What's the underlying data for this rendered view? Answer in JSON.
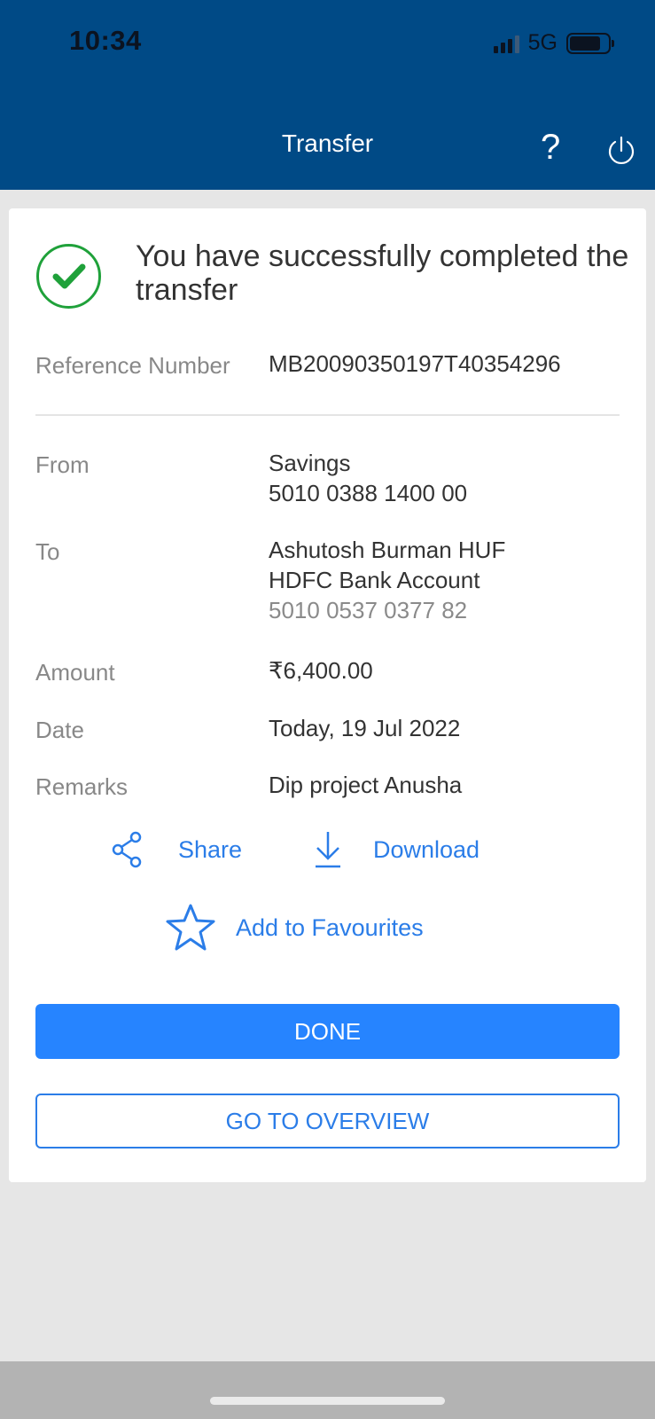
{
  "status": {
    "time": "10:34",
    "network": "5G"
  },
  "header": {
    "title": "Transfer",
    "help_label": "?"
  },
  "success": {
    "message": "You have successfully completed the transfer"
  },
  "reference": {
    "label": "Reference Number",
    "value": "MB20090350197T40354296"
  },
  "from": {
    "label": "From",
    "account_type": "Savings",
    "account_number": "5010 0388 1400 00"
  },
  "to": {
    "label": "To",
    "name": "Ashutosh Burman HUF",
    "bank": "HDFC Bank Account",
    "account_number": "5010 0537 0377 82"
  },
  "amount": {
    "label": "Amount",
    "value": "₹6,400.00"
  },
  "date": {
    "label": "Date",
    "value": "Today, 19 Jul 2022"
  },
  "remarks": {
    "label": "Remarks",
    "value": "Dip project Anusha"
  },
  "actions": {
    "share": "Share",
    "download": "Download",
    "favourites": "Add to Favourites"
  },
  "buttons": {
    "done": "DONE",
    "overview": "GO TO OVERVIEW"
  },
  "colors": {
    "header_bg": "#004a86",
    "accent": "#2684ff",
    "success_green": "#1fa13a"
  }
}
